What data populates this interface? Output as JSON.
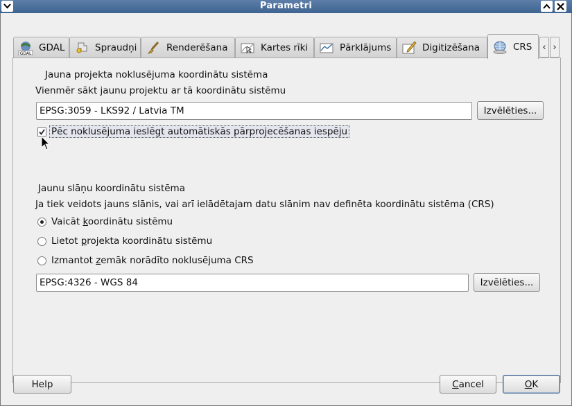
{
  "window": {
    "title": "Parametri"
  },
  "tabs": [
    {
      "label": "GDAL",
      "icon": "gdal-icon"
    },
    {
      "label": "Spraudņi",
      "icon": "plugin-icon"
    },
    {
      "label": "Renderēšana",
      "icon": "brush-icon"
    },
    {
      "label": "Kartes rīki",
      "icon": "map-tools-icon"
    },
    {
      "label": "Pārklājums",
      "icon": "overlay-icon"
    },
    {
      "label": "Digitizēšana",
      "icon": "digitize-icon"
    },
    {
      "label": "CRS",
      "icon": "globe-icon",
      "active": true
    }
  ],
  "project_crs": {
    "heading": "Jauna projekta noklusējuma koordinātu sistēma",
    "description": "Vienmēr sākt jaunu projektu ar tā koordinātu sistēmu",
    "value": "EPSG:3059 - LKS92 / Latvia TM",
    "select_label": "Izvēlēties...",
    "auto_reproject_label": "Pēc noklusējuma ieslēgt automātiskās pārprojecēšanas iespēju",
    "auto_reproject_checked": true
  },
  "layer_crs": {
    "heading": "Jaunu slāņu koordinātu sistēma",
    "description": "Ja tiek veidots jauns slānis, vai arī ielādētajam datu slānim nav definēta koordinātu sistēma (CRS)",
    "options": [
      {
        "pre": "Vaicāt ",
        "key": "k",
        "post": "oordinātu sistēmu",
        "selected": true
      },
      {
        "pre": "Lietot ",
        "key": "p",
        "post": "rojekta koordinātu sistēmu",
        "selected": false
      },
      {
        "pre": "Izmantot ",
        "key": "z",
        "post": "emāk norādīto noklusējuma CRS",
        "selected": false
      }
    ],
    "value": "EPSG:4326 - WGS 84",
    "select_label": "Izvēlēties..."
  },
  "footer": {
    "help": "Help",
    "cancel_key": "C",
    "cancel_rest": "ancel",
    "ok_key": "O",
    "ok_rest": "K"
  }
}
